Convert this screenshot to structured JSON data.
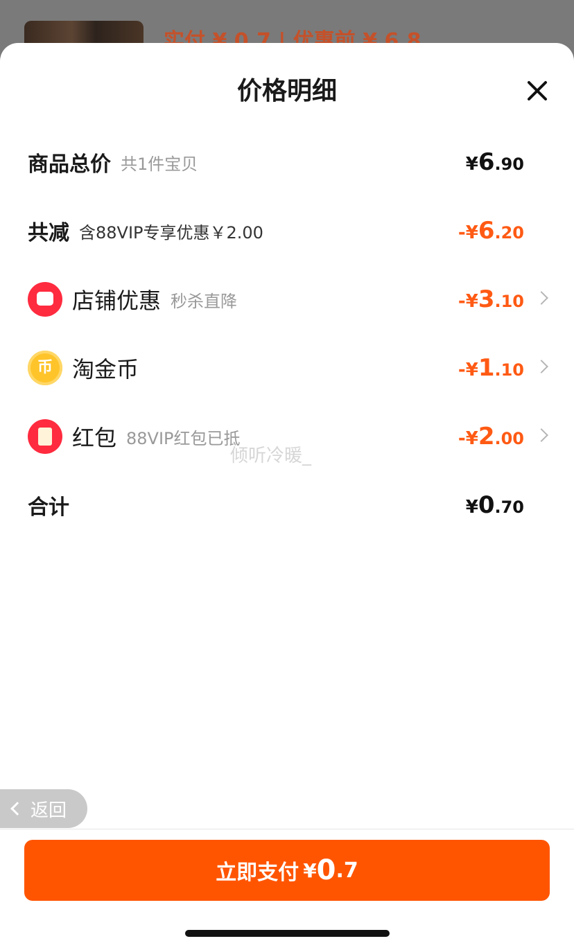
{
  "background": {
    "price_text": "实付 ¥ 0.7 | 优惠前 ¥ 6.8"
  },
  "sheet": {
    "title": "价格明细"
  },
  "rows": {
    "total": {
      "label": "商品总价",
      "sub": "共1件宝贝",
      "cur": "¥",
      "int": "6",
      "dec": ".90"
    },
    "discount": {
      "label": "共减",
      "sub": "含88VIP专享优惠￥2.00",
      "cur": "-¥",
      "int": "6",
      "dec": ".20"
    },
    "store": {
      "label": "店铺优惠",
      "sub": "秒杀直降",
      "cur": "-¥",
      "int": "3",
      "dec": ".10",
      "icon": "store-icon"
    },
    "coin": {
      "label": "淘金币",
      "cur": "-¥",
      "int": "1",
      "dec": ".10",
      "icon": "coin-icon",
      "icon_glyph": "币"
    },
    "redpacket": {
      "label": "红包",
      "sub": "88VIP红包已抵",
      "cur": "-¥",
      "int": "2",
      "dec": ".00",
      "icon": "red-packet-icon"
    },
    "sum": {
      "label": "合计",
      "cur": "¥",
      "int": "0",
      "dec": ".70"
    }
  },
  "watermark": "倾听冷暖_",
  "back": {
    "label": "返回"
  },
  "pay": {
    "label": "立即支付",
    "cur": "¥",
    "int": "0",
    "dec": ".7"
  },
  "colors": {
    "accent": "#ff5500",
    "discount": "#ff5a14",
    "icon_red": "#ff2b3f",
    "coin": "#ffc42a"
  }
}
